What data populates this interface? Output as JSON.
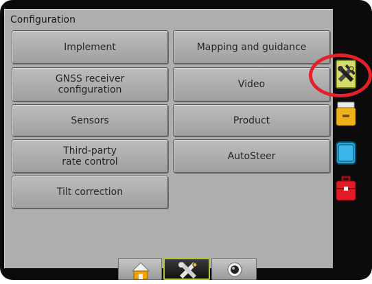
{
  "panel": {
    "title": "Configuration",
    "buttons": {
      "implement": "Implement",
      "mapping": "Mapping and guidance",
      "gnss_line1": "GNSS receiver",
      "gnss_line2": "configuration",
      "video": "Video",
      "sensors": "Sensors",
      "product": "Product",
      "thirdparty_line1": "Third-party",
      "thirdparty_line2": "rate control",
      "autosteer": "AutoSteer",
      "tilt": "Tilt correction"
    }
  },
  "side_tabs": [
    {
      "icon": "wrench-screwdriver-icon",
      "state": "active"
    },
    {
      "icon": "console-icon",
      "state": "inactive"
    },
    {
      "icon": "display-icon",
      "state": "inactive"
    },
    {
      "icon": "toolbox-icon",
      "state": "inactive"
    }
  ],
  "bottom_tabs": [
    {
      "icon": "home-icon"
    },
    {
      "icon": "wrench-screwdriver-icon",
      "state": "active"
    },
    {
      "icon": "camera-icon"
    }
  ],
  "colors": {
    "active_border": "#b7c43a",
    "highlight_ring": "#e4202a",
    "panel_bg": "#aeaeae"
  }
}
